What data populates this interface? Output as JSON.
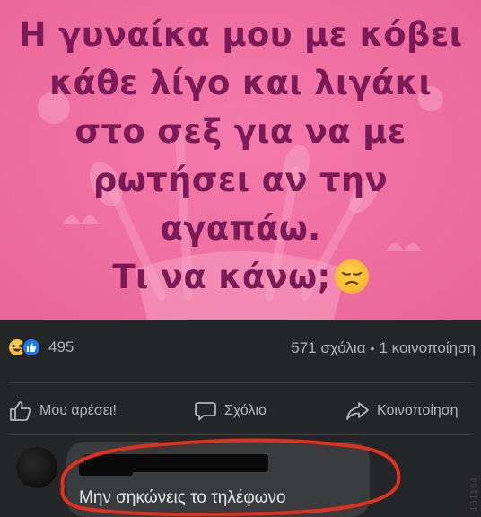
{
  "post_image": {
    "caption_lines": [
      "Η γυναίκα μου με κόβει",
      "κάθε λίγο και λιγάκι",
      "στο σεξ για να με",
      "ρωτήσει αν την",
      "αγαπάω.",
      "Τι να κάνω;"
    ],
    "caption_emoji": "disappointed-face-icon",
    "background_color": "#ef72a3",
    "text_color": "#7a1b57"
  },
  "stats": {
    "reaction_icons": [
      "haha-icon",
      "like-icon"
    ],
    "reaction_count": "495",
    "comments": "571 σχόλια",
    "separator": "•",
    "shares": "1 κοινοποίηση"
  },
  "actions": {
    "like_label": "Μου αρέσει!",
    "comment_label": "Σχόλιο",
    "share_label": "Κοινοποίηση"
  },
  "comment": {
    "text": "Μην σηκώνεις το τηλέφωνο",
    "highlight_color": "#e0301e"
  },
  "watermark": "151164",
  "colors": {
    "fb_background": "#242526",
    "bubble": "#3a3b3c",
    "secondary_text": "#b0b3b8",
    "like_blue": "#1877f2"
  }
}
